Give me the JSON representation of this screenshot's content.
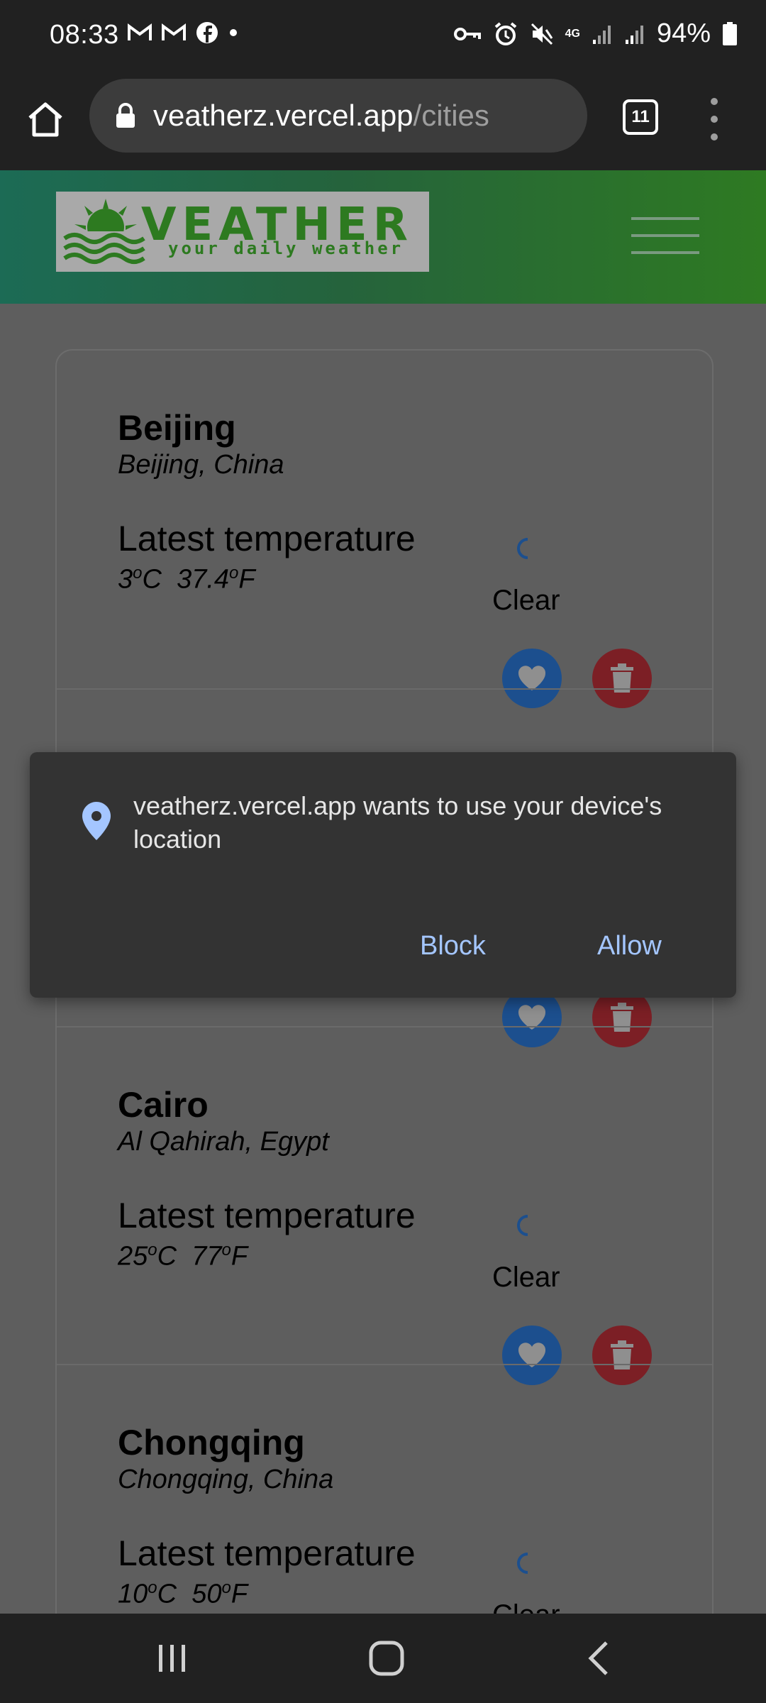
{
  "status_bar": {
    "time": "08:33",
    "left_icons": [
      "gmail-icon",
      "gmail-icon",
      "facebook-icon",
      "dot-icon"
    ],
    "right_icons": [
      "vpn-key-icon",
      "alarm-icon",
      "mute-icon",
      "4g-icon",
      "signal-icon",
      "signal-icon",
      "battery-icon"
    ],
    "network": "4G",
    "battery": "94%"
  },
  "browser": {
    "url_host": "veatherz.vercel.app",
    "url_path": "/cities",
    "tab_count": "11"
  },
  "header": {
    "logo_text": "VEATHER",
    "logo_subtitle": "your daily weather"
  },
  "cities": [
    {
      "name": "Beijing",
      "region": "Beijing, China",
      "temp_label": "Latest temperature",
      "temp_c": "3",
      "temp_f": "37.4",
      "condition": "Clear"
    },
    {
      "name": "",
      "region": "",
      "temp_label": "",
      "temp_c": "",
      "temp_f": "",
      "condition": ""
    },
    {
      "name": "Cairo",
      "region": "Al Qahirah, Egypt",
      "temp_label": "Latest temperature",
      "temp_c": "25",
      "temp_f": "77",
      "condition": "Clear"
    },
    {
      "name": "Chongqing",
      "region": "Chongqing, China",
      "temp_label": "Latest temperature",
      "temp_c": "10",
      "temp_f": "50",
      "condition": "Clear"
    }
  ],
  "dialog": {
    "message": "veatherz.vercel.app wants to use your device's location",
    "block_label": "Block",
    "allow_label": "Allow"
  },
  "colors": {
    "accent_blue": "#1c4f8e",
    "delete_red": "#7c1f25",
    "dialog_link": "#a4c6ff"
  }
}
